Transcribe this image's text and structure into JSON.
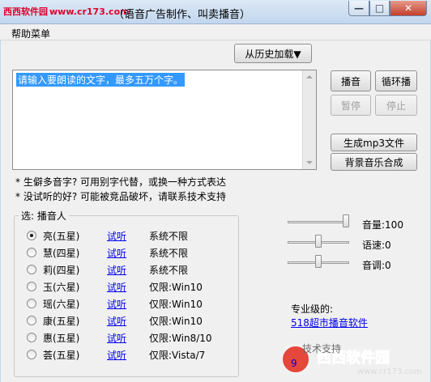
{
  "window": {
    "watermark_logo": "西西软件园",
    "watermark_url": "www.cr173.com",
    "title_fragment": "（语音广告制作、叫卖播音）",
    "minimize_glyph": "—",
    "maximize_glyph": "□",
    "close_glyph": "✕"
  },
  "menu": {
    "help": "帮助菜单"
  },
  "history_button": "从历史加载▼",
  "text_input": {
    "value": "请输入要朗读的文字，最多五万个字。"
  },
  "buttons": {
    "play": "播音",
    "loop": "循环播",
    "pause": "暂停",
    "stop": "停止",
    "make_mp3": "生成mp3文件",
    "bg_music": "背景音乐合成"
  },
  "notes": [
    "* 生僻多音字? 可用别字代替，或换一种方式表达",
    "* 没试听的好? 可能被竞品破坏，请联系技术支持"
  ],
  "voice_group": {
    "title": "选: 播音人",
    "voices": [
      {
        "name": "亮(五星)",
        "try": "试听",
        "limit": "系统不限",
        "selected": true
      },
      {
        "name": "慧(四星)",
        "try": "试听",
        "limit": "系统不限",
        "selected": false
      },
      {
        "name": "莉(四星)",
        "try": "试听",
        "limit": "系统不限",
        "selected": false
      },
      {
        "name": "玉(六星)",
        "try": "试听",
        "limit": "仅限:Win10",
        "selected": false
      },
      {
        "name": "瑶(六星)",
        "try": "试听",
        "limit": "仅限:Win10",
        "selected": false
      },
      {
        "name": "康(五星)",
        "try": "试听",
        "limit": "仅限:Win10",
        "selected": false
      },
      {
        "name": "惠(五星)",
        "try": "试听",
        "limit": "仅限:Win8/10",
        "selected": false
      },
      {
        "name": "荟(五星)",
        "try": "试听",
        "limit": "仅限:Vista/7",
        "selected": false
      }
    ]
  },
  "sliders": {
    "volume": {
      "label": "音量:100",
      "level": 1.0
    },
    "speed": {
      "label": "语速:0",
      "level": 0.5
    },
    "pitch": {
      "label": "音调:0",
      "level": 0.5
    }
  },
  "pro": {
    "title": "专业级的:",
    "link": "518超市播音软件",
    "tech_support": "技术支持",
    "tech_link": "9"
  },
  "watermark_bottom": {
    "text": "西西软件园",
    "url": "www.cr173.com"
  }
}
